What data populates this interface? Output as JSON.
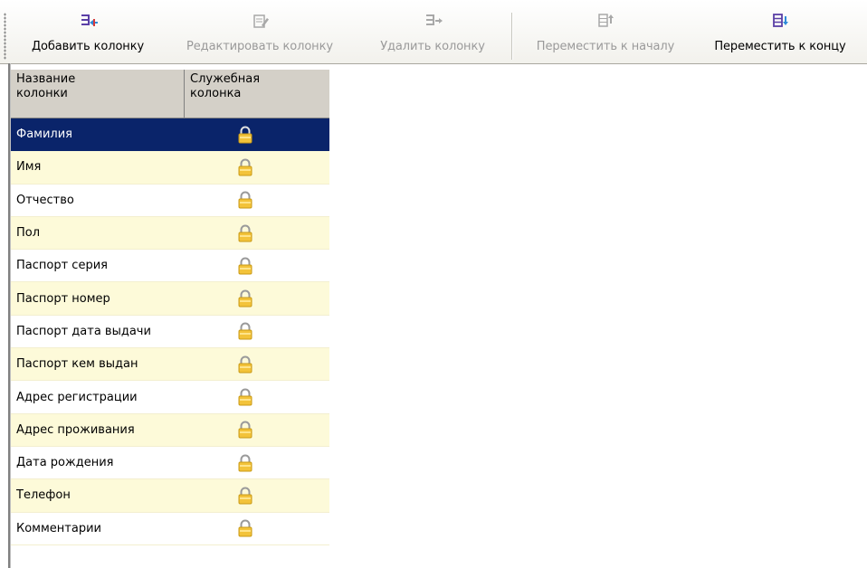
{
  "toolbar": {
    "buttons": [
      {
        "label": "Добавить колонку",
        "enabled": true,
        "icon": "add-column-icon"
      },
      {
        "label": "Редактировать колонку",
        "enabled": false,
        "icon": "edit-column-icon"
      },
      {
        "label": "Удалить колонку",
        "enabled": false,
        "icon": "delete-column-icon"
      },
      {
        "label": "Переместить к началу",
        "enabled": false,
        "icon": "move-to-start-icon"
      },
      {
        "label": "Переместить к концу",
        "enabled": true,
        "icon": "move-to-end-icon"
      }
    ]
  },
  "table": {
    "headers": {
      "name_line1": "Название",
      "name_line2": "колонки",
      "service_line1": "Служебная",
      "service_line2": "колонка"
    },
    "rows": [
      {
        "name": "Фамилия",
        "service": true,
        "selected": true
      },
      {
        "name": "Имя",
        "service": true
      },
      {
        "name": "Отчество",
        "service": true
      },
      {
        "name": "Пол",
        "service": true
      },
      {
        "name": "Паспорт серия",
        "service": true
      },
      {
        "name": "Паспорт номер",
        "service": true
      },
      {
        "name": "Паспорт дата выдачи",
        "service": true
      },
      {
        "name": "Паспорт кем выдан",
        "service": true
      },
      {
        "name": "Адрес регистрации",
        "service": true
      },
      {
        "name": "Адрес проживания",
        "service": true
      },
      {
        "name": "Дата рождения",
        "service": true
      },
      {
        "name": "Телефон",
        "service": true
      },
      {
        "name": "Комментарии",
        "service": true
      }
    ]
  },
  "colors": {
    "selection": "#0a246a",
    "row_alt": "#fdfad9",
    "header_bg": "#d4d0c8",
    "lock": "#f3c33a",
    "icon_enabled": "#5a3fa6",
    "icon_disabled": "#a8a8a8"
  }
}
